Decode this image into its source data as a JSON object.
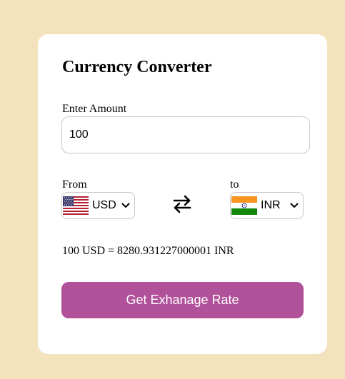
{
  "converter": {
    "title": "Currency Converter",
    "amount_label": "Enter Amount",
    "amount_value": "100",
    "from_label": "From",
    "to_label": "to",
    "from_currency": "USD",
    "to_currency": "INR",
    "result": {
      "amount": "100",
      "from": "USD",
      "equals": "=",
      "value": "8280.931227000001",
      "to": "INR"
    },
    "button_label": "Get Exhanage Rate"
  },
  "icons": {
    "from_flag": "us-flag-icon",
    "to_flag": "india-flag-icon",
    "swap": "swap-arrows-icon",
    "dropdown": "chevron-down-icon"
  },
  "colors": {
    "page_background": "#f2e3bc",
    "card_background": "#ffffff",
    "button_background": "#b05199",
    "button_text": "#ffffff",
    "border": "#c8c8c8"
  }
}
